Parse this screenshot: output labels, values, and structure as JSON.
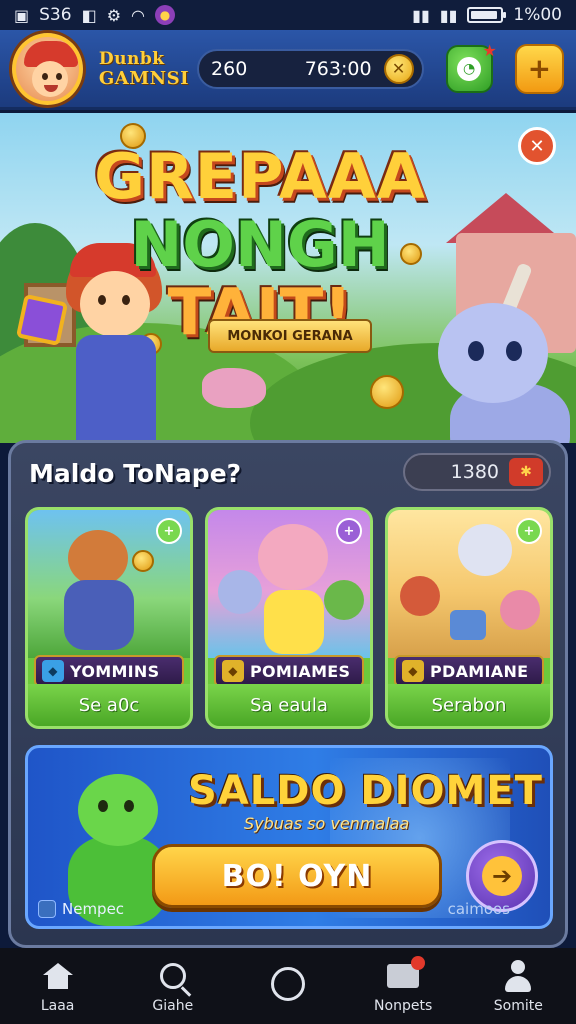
{
  "status_bar": {
    "left_text": "S36",
    "time": "1%00",
    "icons": [
      "image-icon",
      "nfc-icon",
      "gear-icon",
      "wifi-icon",
      "coin-icon",
      "signal-icon",
      "signal-icon",
      "battery-icon"
    ]
  },
  "hud": {
    "brand_line1": "Dunbk",
    "brand_line2": "GAMNSI",
    "resource_value_1": "260",
    "resource_value_2": "763:00",
    "coin_symbol": "✕",
    "green_button_icon": "chat-bubble-icon",
    "yellow_button_symbol": "+"
  },
  "hero": {
    "title_line1": "GREPAAA",
    "title_line2": "NONGH",
    "title_line3": "TAIT!",
    "ribbon_text": "MONKOI GERANA",
    "close_symbol": "✕"
  },
  "panel": {
    "title": "Maldo ToNape?",
    "counter_value": "1380",
    "counter_badge_symbol": "✱",
    "cards": [
      {
        "tag": "YOMMINS",
        "label": "Se a0c",
        "corner": "+",
        "tag_icon": "hex-gem-icon",
        "tag_color": "#3aa0e6"
      },
      {
        "tag": "POMIAMES",
        "label": "Sa eaula",
        "corner": "+",
        "tag_icon": "hex-gem-icon",
        "tag_color": "#e0b22a"
      },
      {
        "tag": "PDAMIANE",
        "label": "Serabon",
        "corner": "+",
        "tag_icon": "hex-gem-icon",
        "tag_color": "#e0b22a"
      }
    ]
  },
  "promo": {
    "title": "SALDO DIOMET",
    "subtitle": "Sybuas so venmalaa",
    "play_label": "BO! OYN",
    "arrow_symbol": "➔",
    "left_label": "Nempec",
    "right_label": "caimoos"
  },
  "bottom_nav": [
    {
      "label": "Laaa",
      "icon": "home-icon"
    },
    {
      "label": "Giahe",
      "icon": "search-icon"
    },
    {
      "label": "",
      "icon": "circle-icon"
    },
    {
      "label": "Nonpets",
      "icon": "mail-icon"
    },
    {
      "label": "Somite",
      "icon": "user-icon"
    }
  ],
  "colors": {
    "hud_blue": "#2b56a8",
    "panel_bg": "#3b4662",
    "card_green": "#6dc93c",
    "promo_blue": "#2f7de6",
    "play_orange": "#f39a16",
    "title_gold": "#ffd03a"
  }
}
